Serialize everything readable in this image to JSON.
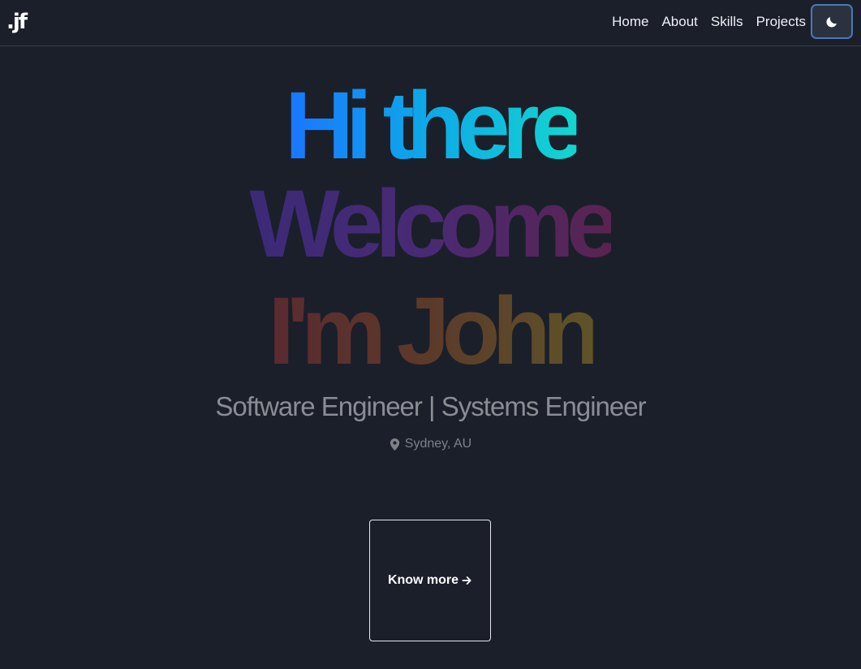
{
  "logo": {
    "text": ".jf"
  },
  "nav": {
    "items": [
      {
        "label": "Home"
      },
      {
        "label": "About"
      },
      {
        "label": "Skills"
      },
      {
        "label": "Projects"
      }
    ],
    "theme_toggle_icon": "moon-icon"
  },
  "hero": {
    "line1": "Hi there",
    "line2": "Welcome",
    "line3": "I'm John",
    "subtitle": "Software Engineer | Systems Engineer",
    "location": "Sydney, AU",
    "location_icon": "map-pin-icon"
  },
  "cta": {
    "label": "Know more",
    "icon": "arrow-right-icon"
  },
  "colors": {
    "background": "#1b1f2a",
    "line1_gradient": [
      "#1a75ff",
      "#12d6cf"
    ],
    "line2_gradient": [
      "#3b2a78",
      "#5a2350"
    ],
    "line3_gradient": [
      "#5a2a30",
      "#5e5428"
    ],
    "accent_border": "#4a78b8"
  }
}
